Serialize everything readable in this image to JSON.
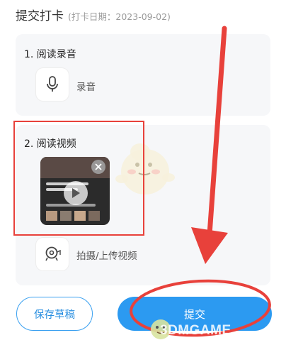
{
  "header": {
    "title": "提交打卡",
    "date_label": "(打卡日期：2023-09-02)"
  },
  "sections": [
    {
      "title": "1. 阅读录音",
      "action_label": "录音",
      "icon": "microphone-icon"
    },
    {
      "title": "2. 阅读视频",
      "action_label": "拍摄/上传视频",
      "icon": "video-camera-icon"
    }
  ],
  "video_thumbnail": {
    "has_play": true,
    "has_close": true
  },
  "buttons": {
    "save_draft": "保存草稿",
    "submit": "提交"
  },
  "watermark": "3DMGAME",
  "colors": {
    "primary": "#2c9af1",
    "annotation": "#e8413b",
    "card": "#f6f7f9"
  }
}
